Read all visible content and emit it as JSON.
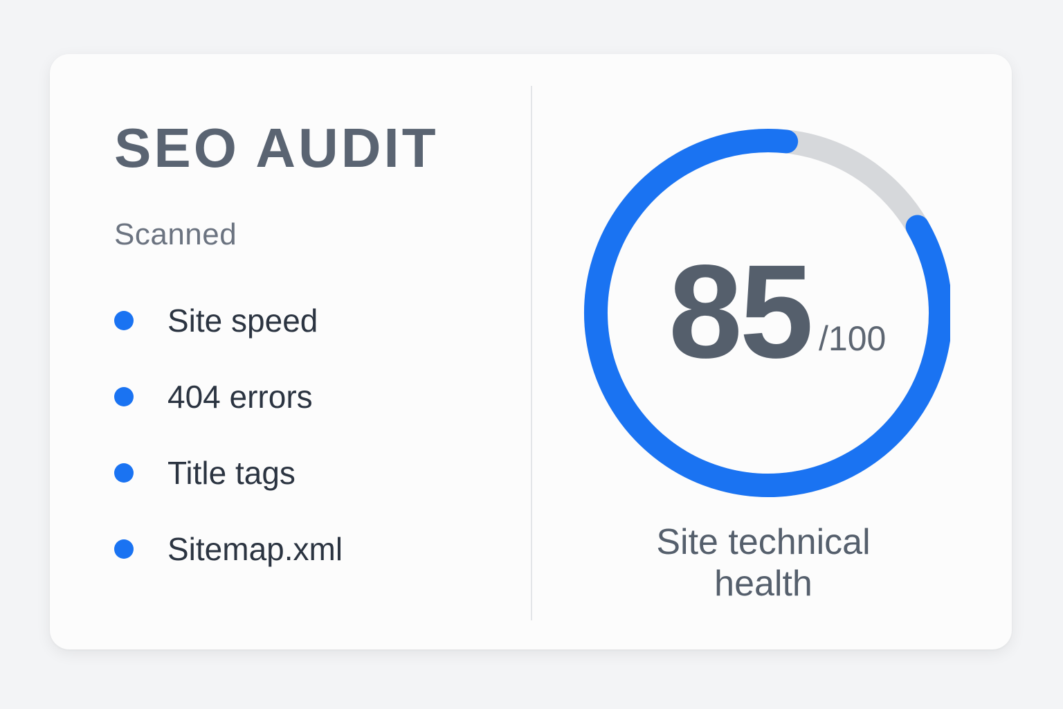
{
  "audit": {
    "title": "SEO AUDIT",
    "scanned_label": "Scanned",
    "items": [
      {
        "label": "Site speed"
      },
      {
        "label": "404 errors"
      },
      {
        "label": "Title tags"
      },
      {
        "label": "Sitemap.xml"
      }
    ]
  },
  "score": {
    "value": "85",
    "max": "/100",
    "fraction": 0.85,
    "caption_line1": "Site technical",
    "caption_line2": "health"
  },
  "colors": {
    "accent": "#1a73f2",
    "track": "#d6d8db",
    "text_dark": "#2b3441",
    "text_muted": "#5a6472"
  },
  "icons": {
    "bullet": "dot-icon"
  }
}
